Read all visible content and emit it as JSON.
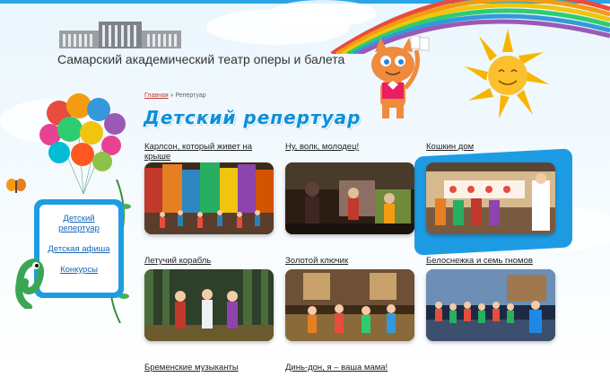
{
  "header": {
    "site_title": "Самарский академический театр оперы и балета"
  },
  "breadcrumb": {
    "home": "Главная",
    "separator": "»",
    "current": "Репертуар"
  },
  "page_title": "Детский репертуар",
  "nav": {
    "items": [
      {
        "label": "Детский репертуар"
      },
      {
        "label": "Детская афиша"
      },
      {
        "label": "Конкурсы"
      }
    ]
  },
  "cards": [
    {
      "title": "Карлсон, который живет на крыше",
      "icon": "stage-scene-image"
    },
    {
      "title": "Ну, волк, молодец!",
      "icon": "stage-scene-image"
    },
    {
      "title": "Кошкин дом",
      "icon": "stage-scene-image"
    },
    {
      "title": "Летучий корабль",
      "icon": "stage-scene-image"
    },
    {
      "title": "Золотой ключик",
      "icon": "stage-scene-image"
    },
    {
      "title": "Белоснежка и семь гномов",
      "icon": "stage-scene-image"
    },
    {
      "title": "Бременские музыканты",
      "icon": "stage-scene-image"
    },
    {
      "title": "Динь-дон, я – ваша мама!",
      "icon": "stage-scene-image"
    }
  ],
  "colors": {
    "accent": "#1d9ce4",
    "title": "#0f8fd8",
    "link": "#1566b8",
    "breadcrumb_home": "#c0392b"
  }
}
